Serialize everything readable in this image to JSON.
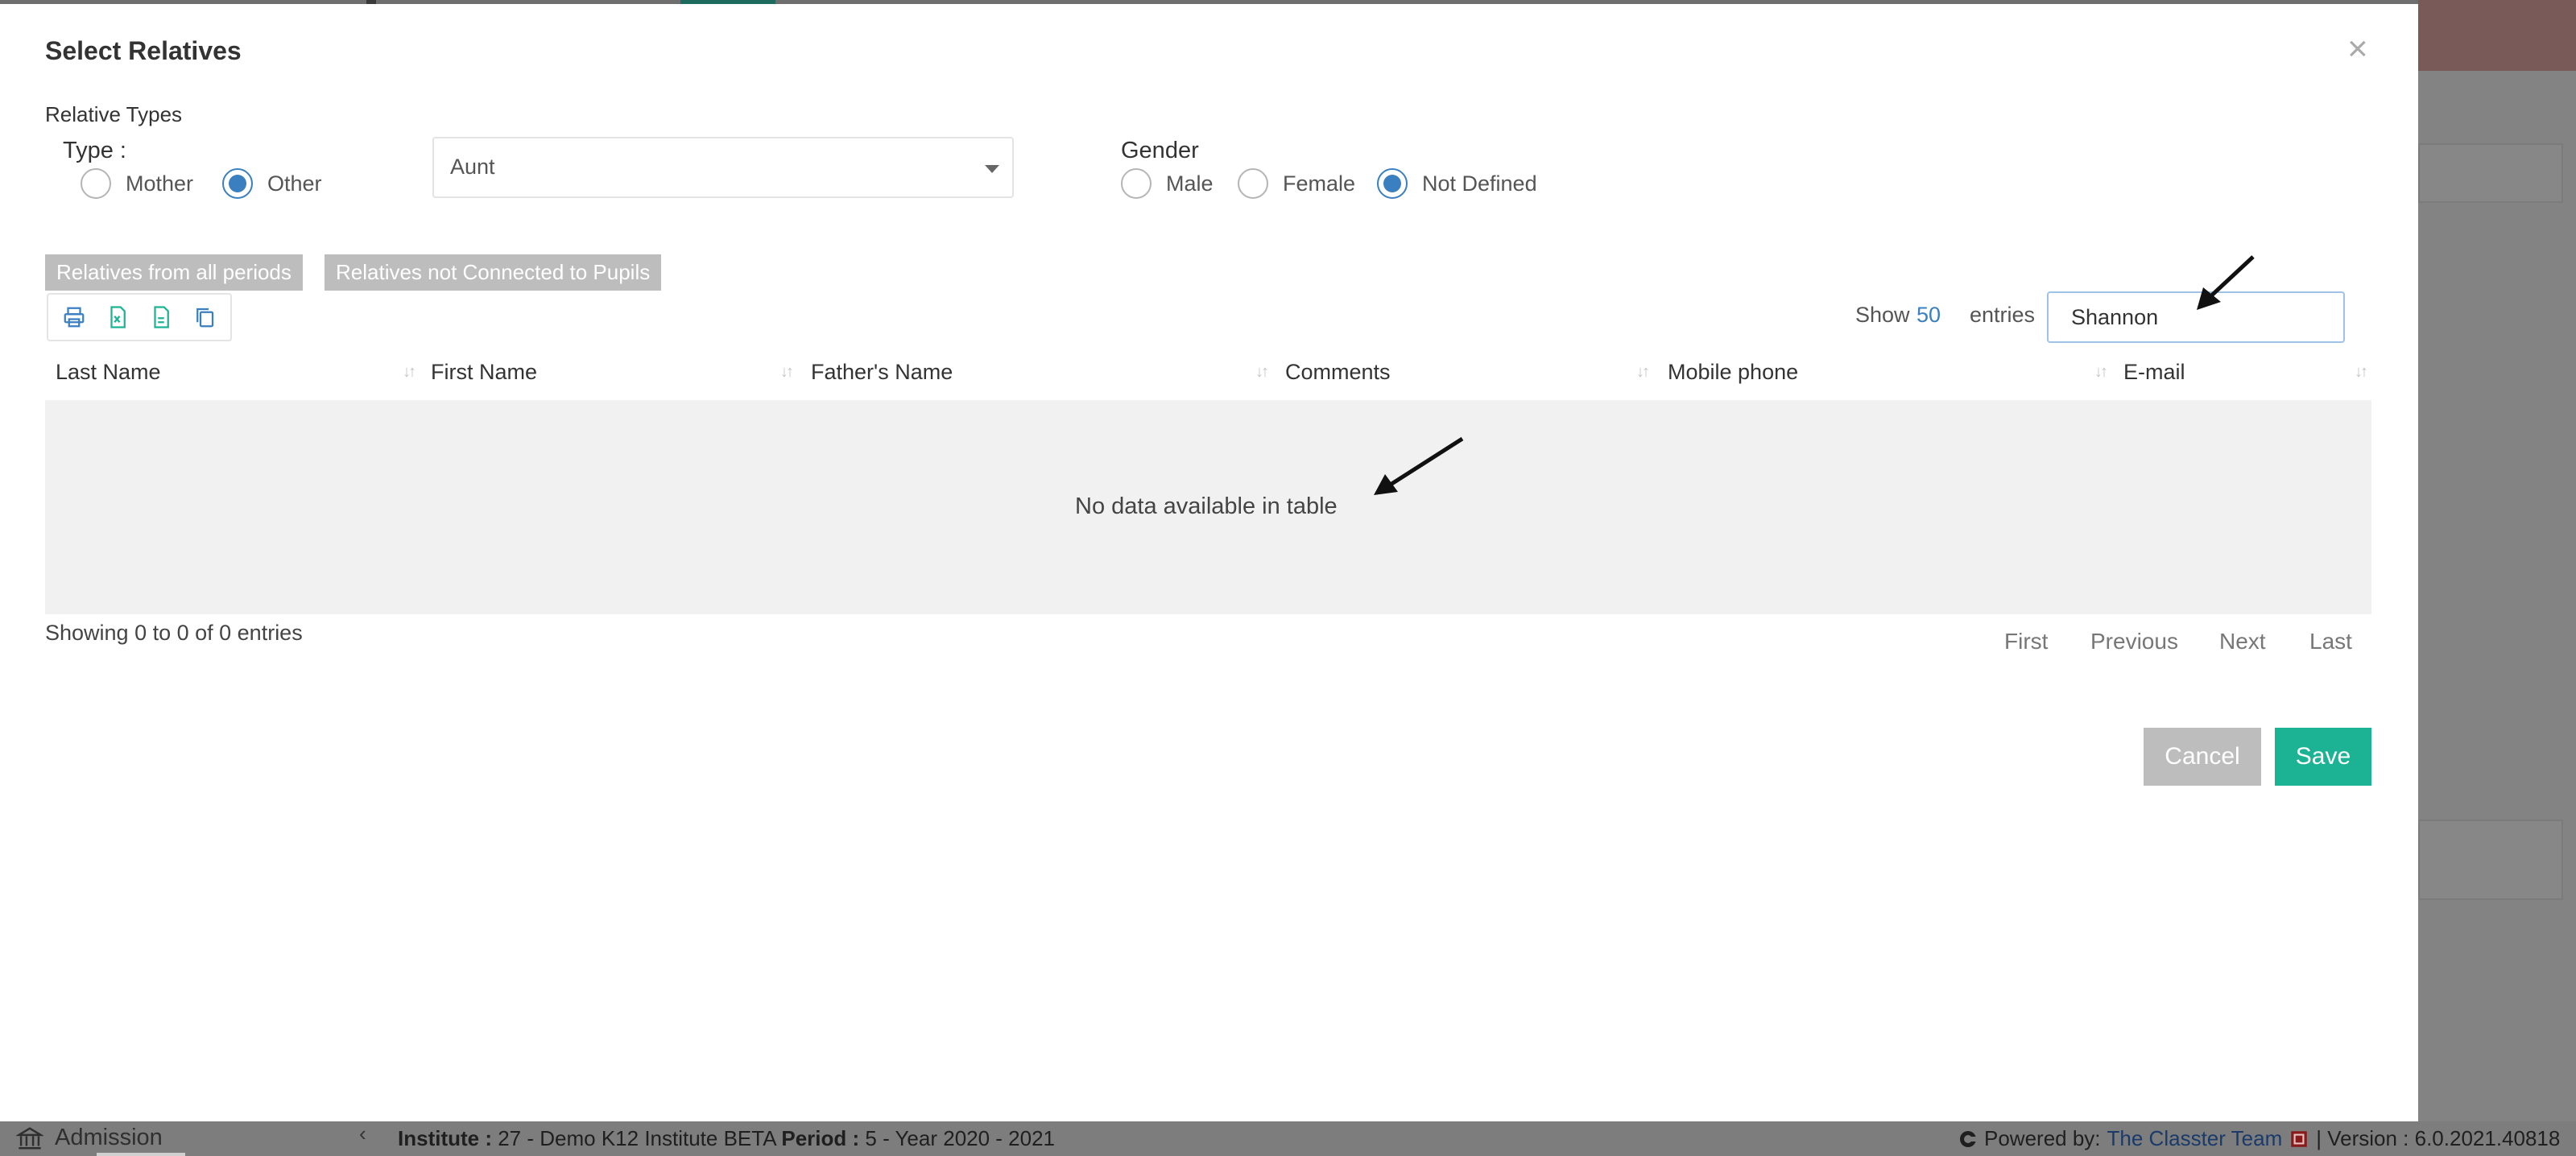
{
  "modal": {
    "title": "Select Relatives",
    "close_symbol": "×"
  },
  "relative_types": {
    "label": "Relative Types",
    "type_label": "Type :",
    "options": [
      {
        "label": "Mother",
        "checked": false
      },
      {
        "label": "Other",
        "checked": true
      }
    ],
    "selected_relation": "Aunt"
  },
  "gender": {
    "label": "Gender",
    "options": [
      {
        "label": "Male",
        "checked": false
      },
      {
        "label": "Female",
        "checked": false
      },
      {
        "label": "Not Defined",
        "checked": true
      }
    ]
  },
  "filters": {
    "all_periods": "Relatives from all periods",
    "not_connected": "Relatives not Connected to Pupils"
  },
  "toolbar": {
    "icons": [
      "print-icon",
      "excel-icon",
      "csv-icon",
      "copy-icon"
    ]
  },
  "length": {
    "show": "Show",
    "count": "50",
    "entries": "entries"
  },
  "search": {
    "value": "Shannon"
  },
  "table": {
    "columns": [
      "Last Name",
      "First Name",
      "Father's Name",
      "Comments",
      "Mobile phone",
      "E-mail"
    ],
    "empty_message": "No data available in table",
    "info": "Showing 0 to 0 of 0 entries"
  },
  "pagination": {
    "first": "First",
    "previous": "Previous",
    "next": "Next",
    "last": "Last"
  },
  "actions": {
    "cancel": "Cancel",
    "save": "Save"
  },
  "footer": {
    "module": "Admission",
    "chevron": "‹",
    "institute_label": "Institute :",
    "institute_value": " 27 - Demo K12 Institute BETA ",
    "period_label": "Period :",
    "period_value": " 5 - Year 2020 - 2021",
    "powered_by": "Powered by:",
    "team": "The Classter Team",
    "version": "| Version : 6.0.2021.40818"
  },
  "colors": {
    "accent": "#1bb394",
    "link": "#3a7fc0",
    "muted_button": "#bdbdbd"
  }
}
